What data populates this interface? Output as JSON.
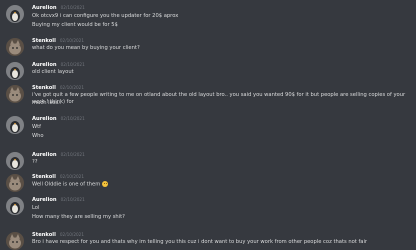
{
  "colors": {
    "background": "#36393f",
    "username": "#ffffff",
    "timestamp": "#72767d",
    "message_text": "#dcddde",
    "emoji": "#f5c33b"
  },
  "messages": [
    {
      "author": "Aurelion",
      "timestamp": "02/10/2021",
      "avatar": "penguin-avatar-icon",
      "lines": [
        "Ok otcvx9 i can configure you the updater for 20$ aprox",
        "Buying my client would be for 5$"
      ]
    },
    {
      "author": "Stenkoll",
      "timestamp": "02/10/2021",
      "avatar": "cat-avatar-icon",
      "lines": [
        "what do you mean by buying your client?"
      ]
    },
    {
      "author": "Aurelion",
      "timestamp": "02/10/2021",
      "avatar": "penguin-avatar-icon",
      "lines": [
        "old client layout"
      ]
    },
    {
      "author": "Stenkoll",
      "timestamp": "02/10/2021",
      "avatar": "cat-avatar-icon",
      "lines": [
        "i've got quit a few people writing to me on otland about the old layout bro.. you said you wanted 90$ for it but people are selling copies of your work ! think) for",
        "much less.."
      ]
    },
    {
      "author": "Aurelion",
      "timestamp": "02/10/2021",
      "avatar": "penguin-avatar-icon",
      "lines": [
        "Wtf",
        "Who"
      ]
    },
    {
      "author": "Aurelion",
      "timestamp": "02/10/2021",
      "avatar": "penguin-avatar-icon",
      "lines": [
        "??"
      ]
    },
    {
      "author": "Stenkoll",
      "timestamp": "02/10/2021",
      "avatar": "cat-avatar-icon",
      "lines": [
        "Well Olddie is one of them"
      ],
      "emoji": "smile-emoji-icon"
    },
    {
      "author": "Aurelion",
      "timestamp": "02/10/2021",
      "avatar": "penguin-avatar-icon",
      "lines": [
        "Lol",
        "How many they are selling my shit?"
      ]
    },
    {
      "author": "Stenkoll",
      "timestamp": "02/10/2021",
      "avatar": "cat-avatar-icon",
      "lines": [
        "Bro i have respect for you and thats why im telling you this cuz i dont want to buy your work from other people coz thats not fair"
      ]
    }
  ]
}
